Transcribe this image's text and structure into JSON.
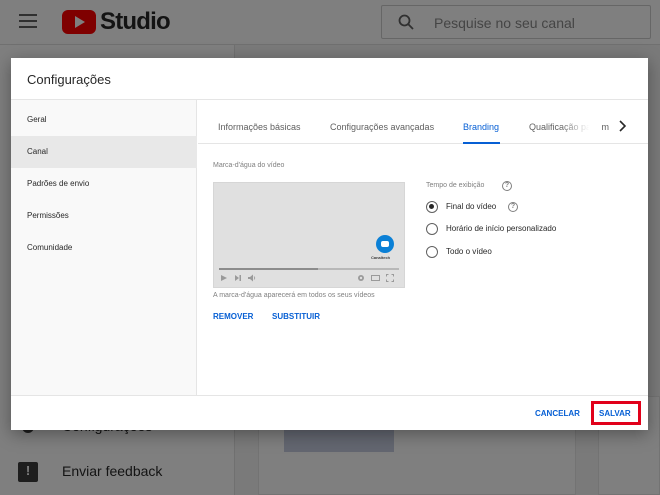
{
  "app": {
    "logo_text": "Studio"
  },
  "search": {
    "placeholder": "Pesquise no seu canal"
  },
  "left_nav": {
    "items": [
      {
        "label": "Configurações",
        "icon": "gear-icon"
      },
      {
        "label": "Enviar feedback",
        "icon": "feedback-icon"
      }
    ]
  },
  "dialog": {
    "title": "Configurações",
    "sidebar": [
      {
        "label": "Geral"
      },
      {
        "label": "Canal",
        "active": true
      },
      {
        "label": "Padrões de envio"
      },
      {
        "label": "Permissões"
      },
      {
        "label": "Comunidade"
      }
    ],
    "tabs": [
      {
        "label": "Informações básicas"
      },
      {
        "label": "Configurações avançadas"
      },
      {
        "label": "Branding",
        "active": true
      },
      {
        "label": "Qualificação para m"
      }
    ],
    "watermark": {
      "section_label": "Marca-d'água do vídeo",
      "watermark_text": "Canaltech",
      "note": "A marca-d'água aparecerá em todos os seus vídeos",
      "remove_label": "REMOVER",
      "replace_label": "SUBSTITUIR",
      "playback_progress": 0.55
    },
    "display_time": {
      "label": "Tempo de exibição",
      "options": [
        {
          "label": "Final do vídeo",
          "checked": true
        },
        {
          "label": "Horário de início personalizado",
          "checked": false
        },
        {
          "label": "Todo o vídeo",
          "checked": false
        }
      ]
    },
    "footer": {
      "cancel_label": "CANCELAR",
      "save_label": "SALVAR"
    }
  },
  "colors": {
    "accent": "#065fd4",
    "highlight_box": "#e1001a",
    "youtube_red": "#ff0000"
  }
}
